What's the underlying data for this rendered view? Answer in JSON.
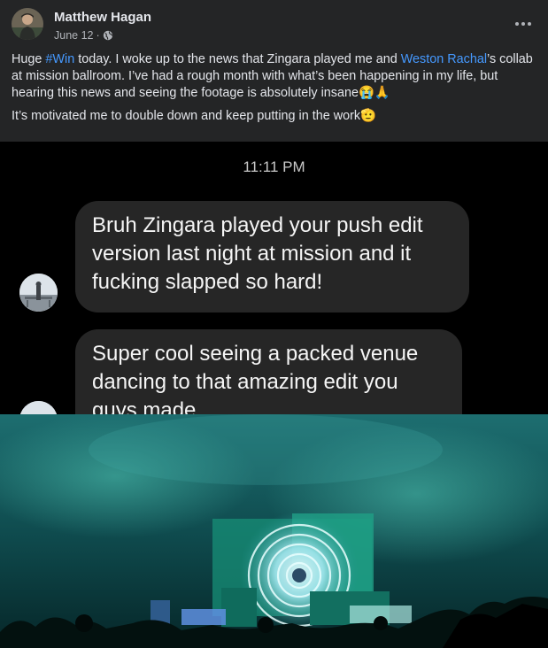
{
  "post": {
    "author": "Matthew Hagan",
    "date": "June 12",
    "separator": " · ",
    "privacy_icon": "globe-icon",
    "more_icon": "more-options-icon",
    "text_p1_a": "Huge ",
    "hashtag": "#Win",
    "text_p1_b": " today. I woke up to the news that Zingara played me and ",
    "mention": "Weston Rachal",
    "text_p1_c": "’s collab at mission ballroom. I’ve had a rough month with what’s been happening in my life, but hearing this news and seeing the footage is absolutely insane😭🙏",
    "text_p2": "It’s motivated me to double down and keep putting in the work🫡"
  },
  "screenshot": {
    "time": "11:11 PM",
    "messages": [
      "Bruh Zingara played your push edit version last night at mission and it fucking slapped so hard!",
      "Super cool seeing a packed venue dancing to that amazing edit you guys made"
    ]
  },
  "colors": {
    "background": "#242526",
    "link": "#4599ff",
    "bubble": "#262626",
    "chat_bg": "#000000"
  }
}
